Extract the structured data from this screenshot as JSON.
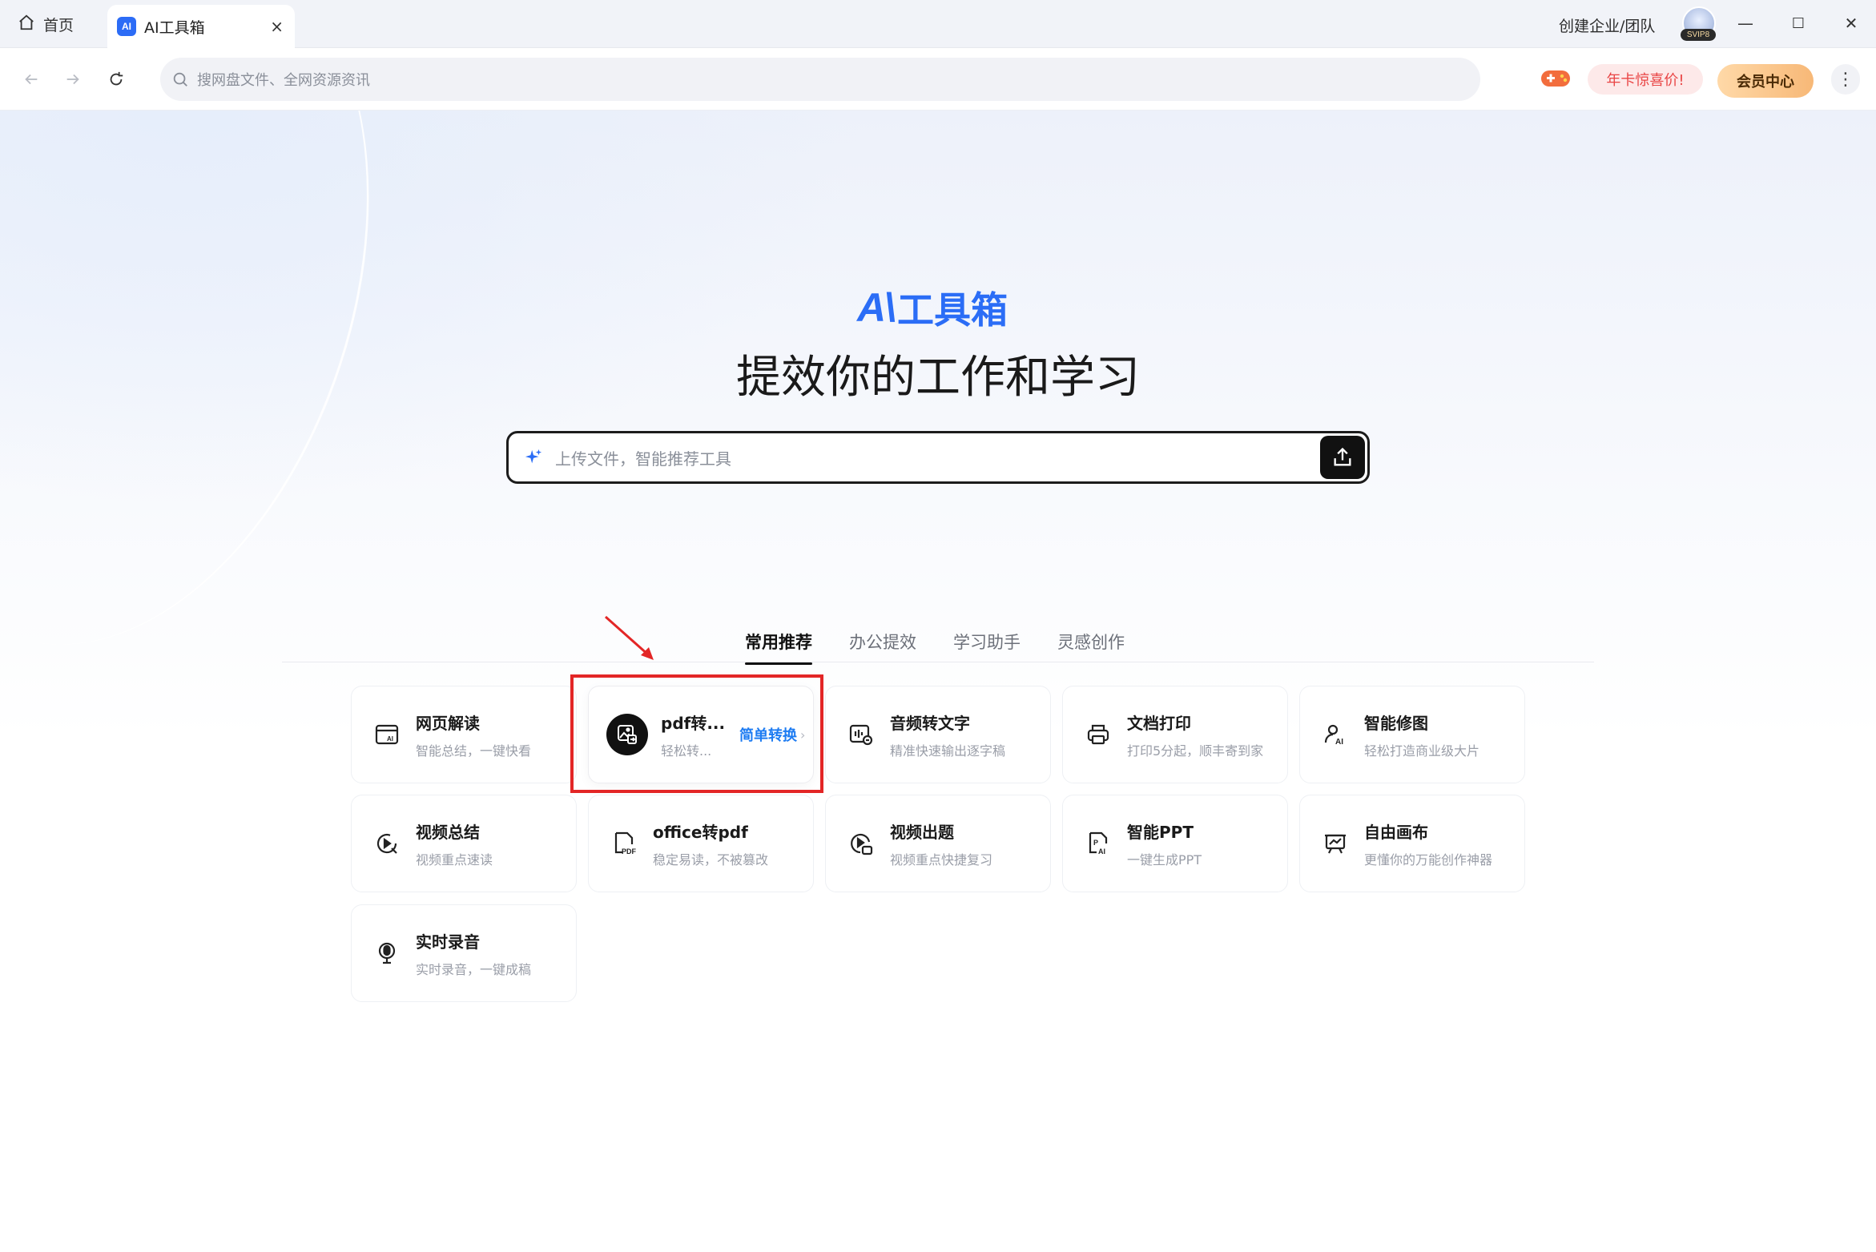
{
  "tabs": {
    "home_label": "首页",
    "active_label": "AI工具箱",
    "active_logo": "AI",
    "close_glyph": "×"
  },
  "window": {
    "team_link": "创建企业/团队",
    "svip_badge": "SVIP8",
    "minimize": "—",
    "maximize": "☐",
    "close": "✕"
  },
  "toolbar": {
    "search_placeholder": "搜网盘文件、全网资源资讯",
    "promo_label": "年卡惊喜价!",
    "vip_label": "会员中心",
    "more_glyph": "⋮"
  },
  "hero": {
    "brand_ai": "A\\",
    "brand_text": "工具箱",
    "headline": "提效你的工作和学习",
    "upload_placeholder": "上传文件，智能推荐工具"
  },
  "category_tabs": [
    "常用推荐",
    "办公提效",
    "学习助手",
    "灵感创作"
  ],
  "tools": [
    {
      "icon": "web-read-icon",
      "title": "网页解读",
      "subtitle": "智能总结，一键快看"
    },
    {
      "icon": "image-convert-icon",
      "title": "pdf转...",
      "subtitle": "轻松转...",
      "cta": "简单转换",
      "cta_chev": "›"
    },
    {
      "icon": "audio-to-text-icon",
      "title": "音频转文字",
      "subtitle": "精准快速输出逐字稿"
    },
    {
      "icon": "printer-icon",
      "title": "文档打印",
      "subtitle": "打印5分起，顺丰寄到家"
    },
    {
      "icon": "ai-retouch-icon",
      "title": "智能修图",
      "subtitle": "轻松打造商业级大片"
    },
    {
      "icon": "video-summary-icon",
      "title": "视频总结",
      "subtitle": "视频重点速读"
    },
    {
      "icon": "pdf-icon",
      "title": "office转pdf",
      "subtitle": "稳定易读，不被篡改"
    },
    {
      "icon": "video-quiz-icon",
      "title": "视频出题",
      "subtitle": "视频重点快捷复习"
    },
    {
      "icon": "ai-ppt-icon",
      "title": "智能PPT",
      "subtitle": "一键生成PPT"
    },
    {
      "icon": "canvas-icon",
      "title": "自由画布",
      "subtitle": "更懂你的万能创作神器"
    },
    {
      "icon": "microphone-icon",
      "title": "实时录音",
      "subtitle": "实时录音，一键成稿"
    }
  ],
  "colors": {
    "brand_blue": "#2b6df6",
    "cta_blue": "#1e7cf2",
    "annotation_red": "#e32626",
    "promo_red": "#e94545"
  }
}
